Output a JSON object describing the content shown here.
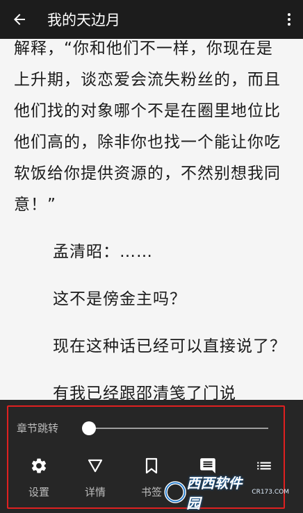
{
  "header": {
    "title": "我的天边月"
  },
  "content": {
    "paragraphs": [
      "解释，“你和他们不一样，你现在是上升期，谈恋爱会流失粉丝的，而且他们找的对象哪个不是在圈里地位比他们高的，除非你也找一个能让你吃软饭给你提供资源的，不然别想我同意！”",
      "孟清昭：……",
      "这不是傍金主吗？",
      "现在这种话已经可以直接说了？",
      "有我已经跟邵清笺了门说"
    ]
  },
  "panel": {
    "chapter_jump_label": "章节跳转",
    "chapter_progress": 0.0,
    "tools": [
      {
        "label": "设置",
        "icon": "gear-icon"
      },
      {
        "label": "详情",
        "icon": "triangle-down-icon"
      },
      {
        "label": "书签",
        "icon": "bookmark-icon"
      },
      {
        "label": "",
        "icon": "comment-icon"
      },
      {
        "label": "",
        "icon": "list-icon"
      }
    ]
  },
  "watermark": {
    "logo_text": "西西软件园",
    "url": "CR173.COM"
  },
  "colors": {
    "topbar": "#1c1c1c",
    "page_bg": "#f5f5f5",
    "panel_bg": "#262626",
    "highlight_border": "#e02020",
    "watermark_blue": "#1a74c8"
  }
}
